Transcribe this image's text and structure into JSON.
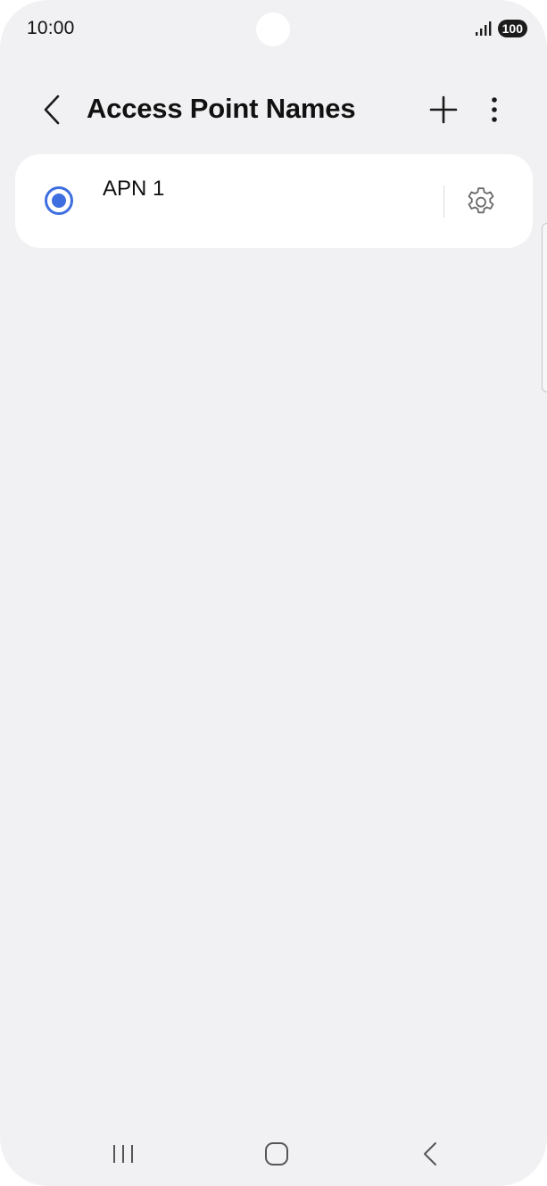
{
  "status_bar": {
    "time": "10:00",
    "battery": "100"
  },
  "header": {
    "title": "Access Point Names",
    "icons": {
      "back": "chevron-left-icon",
      "add": "plus-icon",
      "more": "more-vertical-icon"
    }
  },
  "apn_list": [
    {
      "name": "APN 1",
      "selected": true
    }
  ],
  "colors": {
    "accent": "#3e6fe0",
    "background": "#f1f1f3",
    "card": "#ffffff"
  },
  "nav_bar": {
    "icons": [
      "recents-icon",
      "home-icon",
      "back-icon"
    ]
  }
}
